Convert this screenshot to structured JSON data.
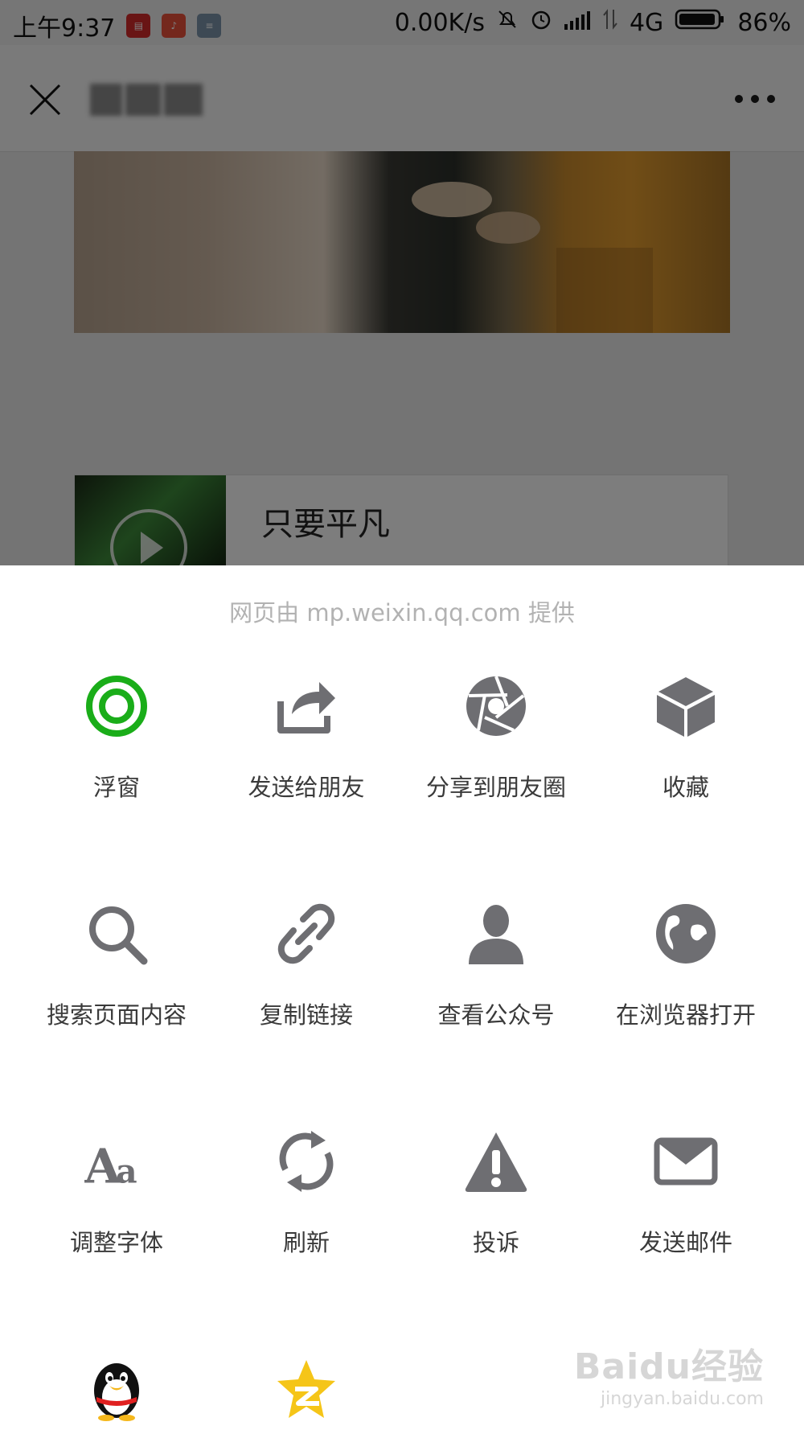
{
  "status_bar": {
    "time": "上午9:37",
    "net_speed": "0.00K/s",
    "network": "4G",
    "battery": "86%"
  },
  "article": {
    "music_title": "只要平凡"
  },
  "sheet": {
    "provider_text": "网页由 mp.weixin.qq.com 提供",
    "row1": [
      {
        "label": "浮窗",
        "icon": "floating-window-icon"
      },
      {
        "label": "发送给朋友",
        "icon": "share-arrow-icon"
      },
      {
        "label": "分享到朋友圈",
        "icon": "moments-aperture-icon"
      },
      {
        "label": "收藏",
        "icon": "favorite-cube-icon"
      }
    ],
    "row2": [
      {
        "label": "搜索页面内容",
        "icon": "search-icon"
      },
      {
        "label": "复制链接",
        "icon": "link-icon"
      },
      {
        "label": "查看公众号",
        "icon": "person-icon"
      },
      {
        "label": "在浏览器打开",
        "icon": "globe-icon"
      }
    ],
    "row3": [
      {
        "label": "调整字体",
        "icon": "font-size-icon"
      },
      {
        "label": "刷新",
        "icon": "refresh-icon"
      },
      {
        "label": "投诉",
        "icon": "warning-icon"
      },
      {
        "label": "发送邮件",
        "icon": "mail-icon"
      }
    ],
    "row4": [
      {
        "icon": "qq-penguin-icon"
      },
      {
        "icon": "qzone-star-icon"
      }
    ]
  },
  "watermark": {
    "brand": "Baidu经验",
    "url": "jingyan.baidu.com"
  },
  "colors": {
    "accent_green": "#1aad19",
    "icon_gray": "#6e6e72",
    "label_gray": "#3a3a3a",
    "provider_gray": "#b2b2b2"
  }
}
